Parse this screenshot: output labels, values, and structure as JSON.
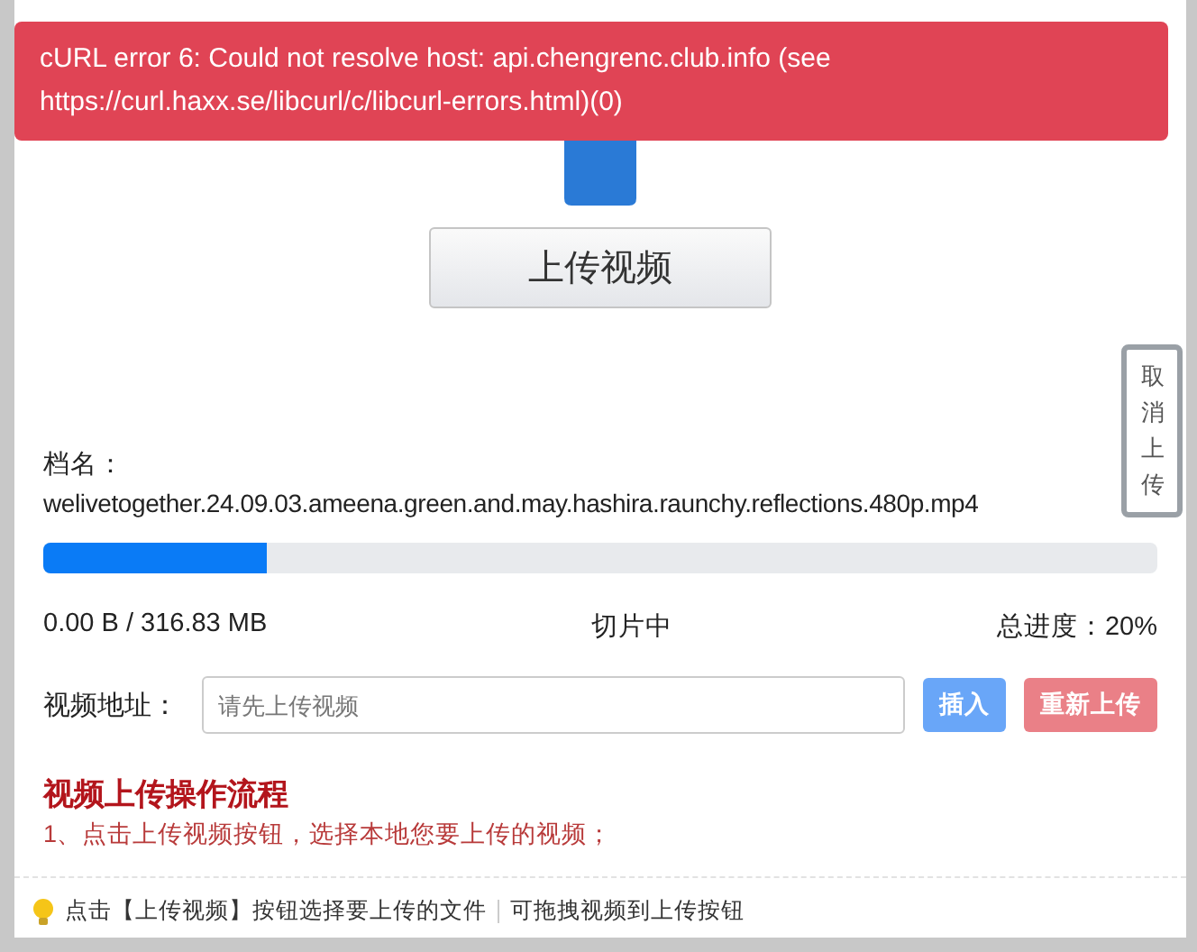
{
  "error_toast": {
    "message": "cURL error 6: Could not resolve host: api.chengrenc.club.info (see https://curl.haxx.se/libcurl/c/libcurl-errors.html)(0)"
  },
  "upload_button": {
    "label": "上传视频"
  },
  "file": {
    "label": "档名：",
    "name": "welivetogether.24.09.03.ameena.green.and.may.hashira.raunchy.reflections.480p.mp4"
  },
  "cancel_button": {
    "label": "取消上传"
  },
  "progress": {
    "level": 0.2,
    "size": "0.00 B / 316.83 MB",
    "status": "切片中",
    "total": "总进度：20%"
  },
  "video_url": {
    "label": "视频地址：",
    "placeholder": "请先上传视频"
  },
  "buttons": [
    {
      "label": "插入",
      "kind": "insert"
    },
    {
      "label": "重新上传",
      "kind": "reupload"
    }
  ],
  "guide": {
    "title": "视频上传操作流程",
    "steps": [
      "1、点击上传视频按钮，选择本地您要上传的视频；"
    ]
  },
  "footer": {
    "hint": "点击【上传视频】按钮选择要上传的文件",
    "extra": "可拖拽视频到上传按钮"
  }
}
